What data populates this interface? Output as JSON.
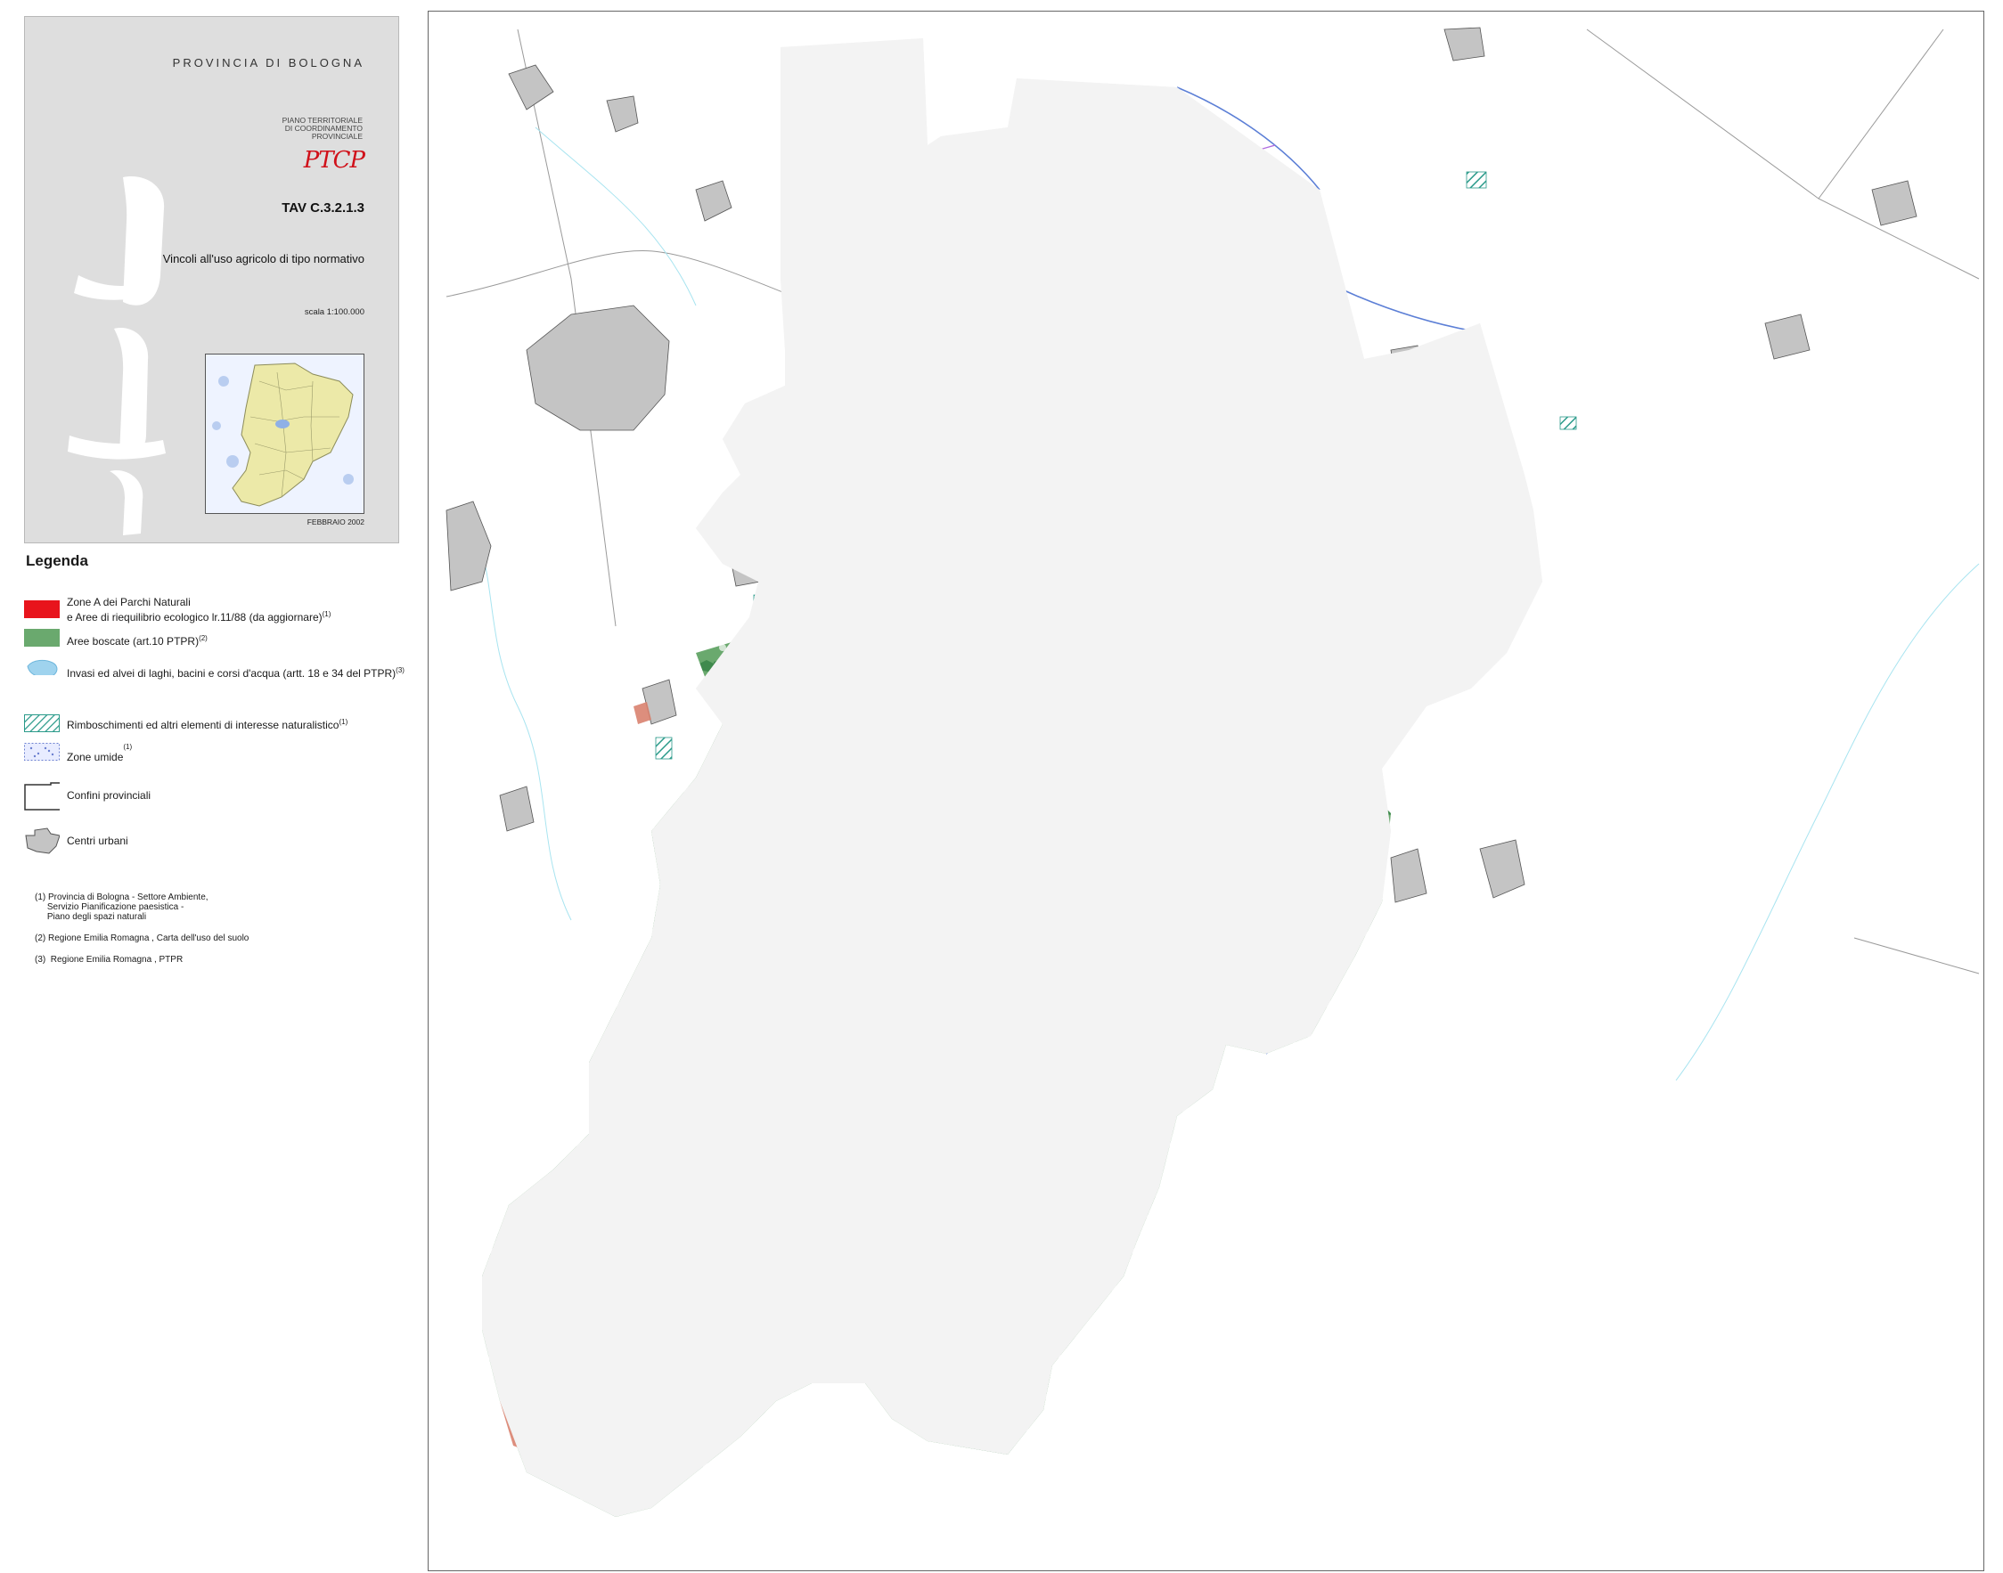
{
  "title_block": {
    "province": "PROVINCIA DI BOLOGNA",
    "plan_lines": [
      "PIANO TERRITORIALE",
      "DI COORDINAMENTO",
      "PROVINCIALE"
    ],
    "logo": "PTCP",
    "table_code": "TAV C.3.2.1.3",
    "subject": "Vincoli all'uso agricolo di tipo normativo",
    "scale": "scala 1:100.000",
    "date": "FEBBRAIO 2002"
  },
  "legend": {
    "title": "Legenda",
    "items": [
      {
        "id": "zone-a",
        "text_lines": [
          "Zone A  dei Parchi Naturali",
          "e Aree di riequilibrio ecologico lr.11/88 (da aggiornare)"
        ],
        "sup": "(1)",
        "color": "#e8141c"
      },
      {
        "id": "aree-boscate",
        "text_lines": [
          "Aree boscate (art.10 PTPR)"
        ],
        "sup": "(2)",
        "color": "#6aa96e"
      },
      {
        "id": "invasi",
        "text_lines": [
          "Invasi ed alvei di laghi, bacini e corsi d'acqua (artt. 18 e 34 del PTPR)"
        ],
        "sup": "(3)",
        "color": "#9fd3ee"
      },
      {
        "id": "rimboschimenti",
        "text_lines": [
          "Rimboschimenti  ed altri elementi di interesse naturalistico"
        ],
        "sup": "(1)",
        "color": "#2a9a8a"
      },
      {
        "id": "zone-umide",
        "text_lines": [
          "Zone umide"
        ],
        "sup": "(1)",
        "color": "#6a7fd0"
      },
      {
        "id": "confini",
        "text_lines": [
          "Confini provinciali"
        ],
        "sup": "",
        "color": "#333333"
      },
      {
        "id": "centri",
        "text_lines": [
          "Centri urbani"
        ],
        "sup": "",
        "color": "#c4c4c4"
      }
    ],
    "notes": [
      "(1) Provincia di Bologna - Settore Ambiente,\n     Servizio Pianificazione paesistica -\n     Piano degli spazi naturali",
      "(2) Regione Emilia Romagna , Carta dell'uso del suolo",
      "(3)  Regione Emilia Romagna , PTPR"
    ]
  },
  "map": {
    "colors": {
      "forest": "#6aa96e",
      "forest_dark": "#3f8a4d",
      "urban": "#c4c4c4",
      "relief": "#e6e6e6",
      "boundary": "#444444",
      "river": "#5c7fd6",
      "channel": "#b06be0",
      "zone_a": "#d9826f",
      "hatch": "#2a9a8a",
      "inset_fill": "#ece9a8"
    }
  }
}
